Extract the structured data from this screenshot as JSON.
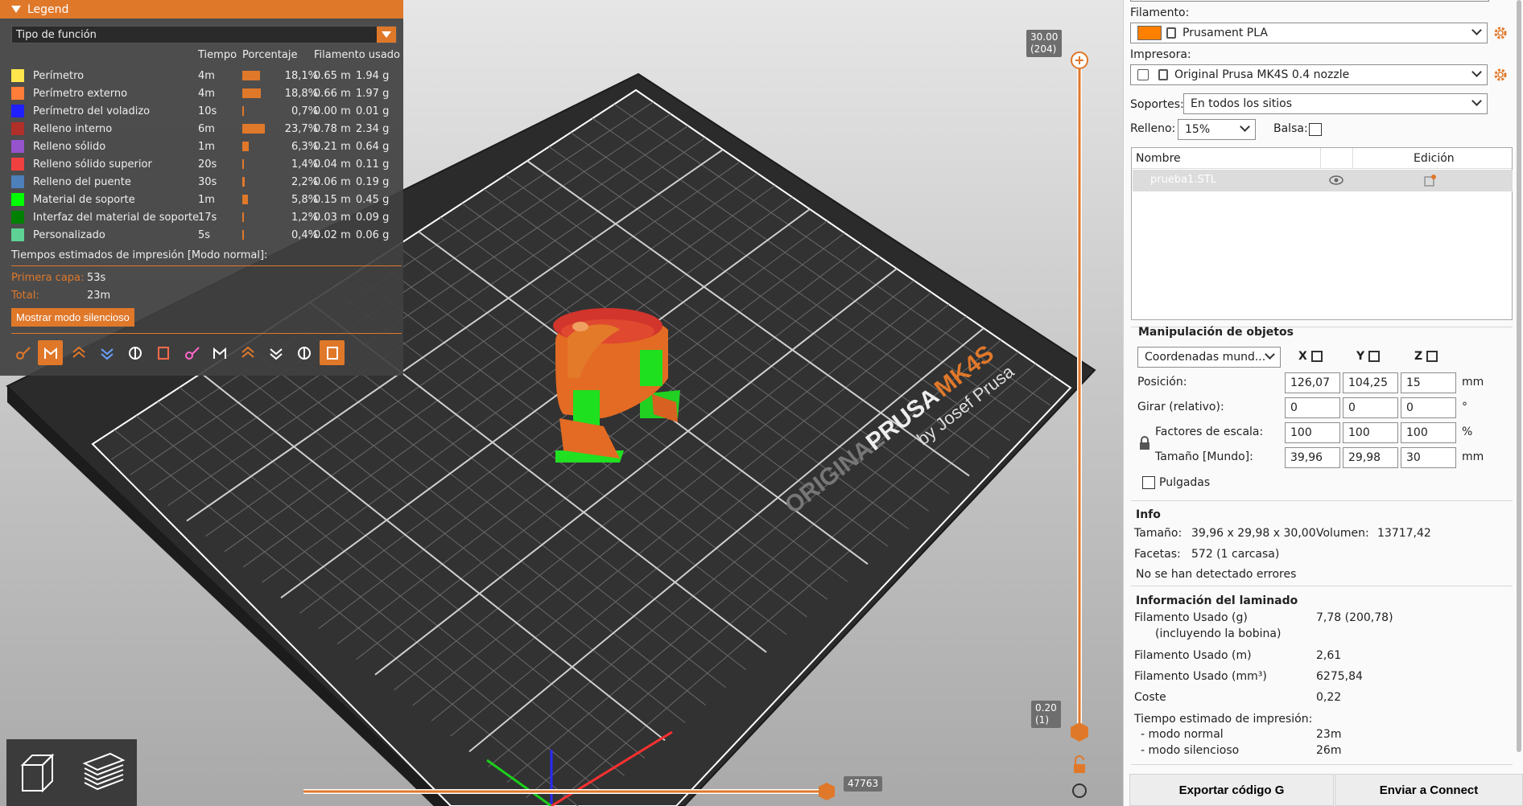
{
  "legend": {
    "title": "Legend",
    "feature_type": "Tipo de función",
    "columns": {
      "time": "Tiempo",
      "percent": "Porcentaje",
      "filament": "Filamento usado"
    },
    "rows": [
      {
        "name": "Perímetro",
        "time": "4m",
        "percent": "18,1%",
        "pct": 0.181,
        "m": "0.65 m",
        "g": "1.94 g",
        "color": "#ffe64d"
      },
      {
        "name": "Perímetro externo",
        "time": "4m",
        "percent": "18,8%",
        "pct": 0.188,
        "m": "0.66 m",
        "g": "1.97 g",
        "color": "#ff7d38"
      },
      {
        "name": "Perímetro del voladizo",
        "time": "10s",
        "percent": "0,7%",
        "pct": 0.007,
        "m": "0.00 m",
        "g": "0.01 g",
        "color": "#1f1fff"
      },
      {
        "name": "Relleno interno",
        "time": "6m",
        "percent": "23,7%",
        "pct": 0.237,
        "m": "0.78 m",
        "g": "2.34 g",
        "color": "#b03029"
      },
      {
        "name": "Relleno sólido",
        "time": "1m",
        "percent": "6,3%",
        "pct": 0.063,
        "m": "0.21 m",
        "g": "0.64 g",
        "color": "#9654cc"
      },
      {
        "name": "Relleno sólido superior",
        "time": "20s",
        "percent": "1,4%",
        "pct": 0.014,
        "m": "0.04 m",
        "g": "0.11 g",
        "color": "#f04040"
      },
      {
        "name": "Relleno del puente",
        "time": "30s",
        "percent": "2,2%",
        "pct": 0.022,
        "m": "0.06 m",
        "g": "0.19 g",
        "color": "#4d80ba"
      },
      {
        "name": "Material de soporte",
        "time": "1m",
        "percent": "5,8%",
        "pct": 0.058,
        "m": "0.15 m",
        "g": "0.45 g",
        "color": "#00ff00"
      },
      {
        "name": "Interfaz del material de soporte",
        "time": "17s",
        "percent": "1,2%",
        "pct": 0.012,
        "m": "0.03 m",
        "g": "0.09 g",
        "color": "#008000"
      },
      {
        "name": "Personalizado",
        "time": "5s",
        "percent": "0,4%",
        "pct": 0.004,
        "m": "0.02 m",
        "g": "0.06 g",
        "color": "#5ed194"
      }
    ],
    "estimates_title": "Tiempos estimados de impresión [Modo normal]:",
    "first_layer_label": "Primera capa:",
    "first_layer_value": "53s",
    "total_label": "Total:",
    "total_value": "23m",
    "silent_button": "Mostrar modo silencioso"
  },
  "toolbar_icons": [
    "travel-icon",
    "wipe-icon",
    "retractions-icon",
    "deretractions-icon",
    "seams-icon",
    "tool-changes-icon",
    "color-changes-icon",
    "pause-icon",
    "custom-gcode-icon",
    "center-of-gravity-icon",
    "shells-icon",
    "tool-marker-icon"
  ],
  "bed_logo": {
    "line1": "ORIGINAL",
    "brand": "PRUSA",
    "model": "MK4S",
    "by": "by Josef Prusa"
  },
  "vertical_slider": {
    "top_value": "30.00",
    "top_layer": "(204)",
    "bottom_value": "0.20",
    "bottom_layer": "(1)"
  },
  "horizontal_slider": {
    "value": "47763"
  },
  "right_panel": {
    "filament_label": "Filamento:",
    "filament_value": "Prusament PLA",
    "filament_color": "#ff8000",
    "printer_label": "Impresora:",
    "printer_value": "Original Prusa MK4S 0.4 nozzle",
    "supports_label": "Soportes:",
    "supports_value": "En todos los sitios",
    "infill_label": "Relleno:",
    "infill_value": "15%",
    "brim_label": "Balsa:",
    "list_col_name": "Nombre",
    "list_col_edit": "Edición",
    "object_name": "prueba1.STL",
    "manip_title": "Manipulación de objetos",
    "coords_value": "Coordenadas mund...",
    "axis_x": "X",
    "axis_y": "Y",
    "axis_z": "Z",
    "position_label": "Posición:",
    "position": [
      "126,07",
      "104,25",
      "15"
    ],
    "position_unit": "mm",
    "rotate_label": "Girar (relativo):",
    "rotate": [
      "0",
      "0",
      "0"
    ],
    "rotate_unit": "°",
    "scale_label": "Factores de escala:",
    "scale": [
      "100",
      "100",
      "100"
    ],
    "scale_unit": "%",
    "size_label": "Tamaño [Mundo]:",
    "size": [
      "39,96",
      "29,98",
      "30"
    ],
    "size_unit": "mm",
    "inches_label": "Pulgadas",
    "info_title": "Info",
    "info_size_label": "Tamaño:",
    "info_size_value": "39,96 x 29,98 x 30,00",
    "info_volume_label": "Volumen:",
    "info_volume_value": "13717,42",
    "info_facets_label": "Facetas:",
    "info_facets_value": "572 (1 carcasa)",
    "info_errors": "No se han detectado errores",
    "slice_title": "Información del laminado",
    "slice_rows": [
      {
        "label": "Filamento Usado (g)",
        "value": "7,78 (200,78)"
      },
      {
        "label": "(incluyendo la bobina)",
        "value": ""
      },
      {
        "label": "Filamento Usado (m)",
        "value": "2,61"
      },
      {
        "label": "Filamento Usado (mm³)",
        "value": "6275,84"
      },
      {
        "label": "Coste",
        "value": "0,22"
      },
      {
        "label": "Tiempo estimado de impresión:",
        "value": ""
      },
      {
        "label": "- modo normal",
        "value": "23m"
      },
      {
        "label": "- modo silencioso",
        "value": "26m"
      }
    ],
    "export_button": "Exportar código G",
    "connect_button": "Enviar a Connect"
  }
}
